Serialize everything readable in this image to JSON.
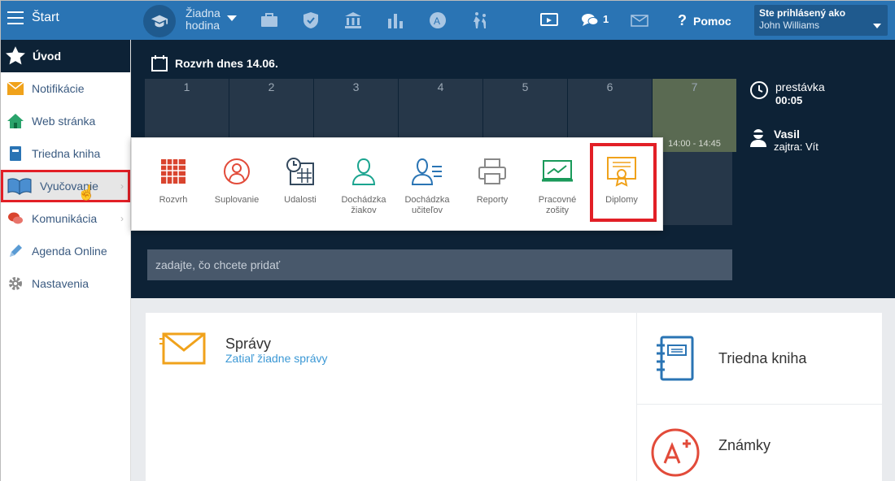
{
  "topbar": {
    "start_label": "Štart",
    "hodina": [
      "Žiadna",
      "hodina"
    ],
    "msg_count": "1",
    "help": "Pomoc",
    "user_caption": "Ste prihlásený ako",
    "user_name": "John Williams"
  },
  "sidebar": {
    "home": "Úvod",
    "items": [
      {
        "label": "Notifikácie",
        "icon": "envelope-icon"
      },
      {
        "label": "Web stránka",
        "icon": "house-icon"
      },
      {
        "label": "Triedna kniha",
        "icon": "book-icon"
      },
      {
        "label": "Vyučovanie",
        "icon": "open-book-icon"
      },
      {
        "label": "Komunikácia",
        "icon": "chat-icon"
      },
      {
        "label": "Agenda Online",
        "icon": "pencil-icon"
      },
      {
        "label": "Nastavenia",
        "icon": "gear-icon"
      }
    ]
  },
  "schedule": {
    "title": "Rozvrh dnes 14.06.",
    "periods": [
      "1",
      "2",
      "3",
      "4",
      "5",
      "6",
      "7"
    ],
    "period7_time": "14:00 - 14:45",
    "break_label": "prestávka",
    "break_time": "00:05",
    "next_name": "Vasil",
    "next_sub": "zajtra: Vít"
  },
  "add_placeholder": "zadajte, čo chcete pridať",
  "popup": [
    {
      "label": "Rozvrh",
      "icon": "grid-calendar-icon"
    },
    {
      "label": "Suplovanie",
      "icon": "person-swap-icon"
    },
    {
      "label": "Udalosti",
      "icon": "clock-calendar-icon"
    },
    {
      "label": "Dochádzka žiakov",
      "icon": "student-icon"
    },
    {
      "label": "Dochádzka učiteľov",
      "icon": "teacher-icon"
    },
    {
      "label": "Reporty",
      "icon": "printer-icon"
    },
    {
      "label": "Pracovné zošity",
      "icon": "board-icon"
    },
    {
      "label": "Diplomy",
      "icon": "diploma-icon"
    }
  ],
  "cards": {
    "spravy_title": "Správy",
    "spravy_sub": "Zatiaľ žiadne správy",
    "triedna": "Triedna kniha",
    "znamky": "Známky"
  },
  "colors": {
    "topbar": "#2a74b4",
    "dark": "#0d2236",
    "highlight": "#e21f26",
    "accent": "#3b98d5"
  }
}
